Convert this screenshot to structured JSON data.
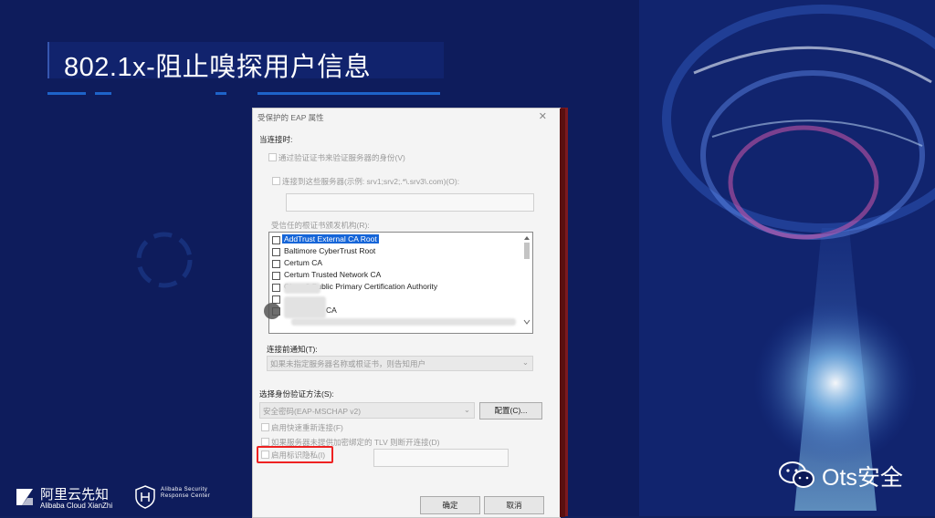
{
  "slide": {
    "title": "802.1x-阻止嗅探用户信息",
    "brand_main": "阿里云先知",
    "brand_sub": "Alibaba Cloud XianZhi",
    "brand2_line1": "Alibaba Security",
    "brand2_line2": "Response Center",
    "wechat_label": "Ots安全"
  },
  "dialog": {
    "title": "受保护的 EAP 属性",
    "close_glyph": "✕",
    "connect_label": "当连接时:",
    "verify_cert_label": "通过验证证书来验证服务器的身份(V)",
    "connect_servers_label": "连接到这些服务器(示例: srv1;srv2;.*\\.srv3\\.com)(O):",
    "trusted_ca_label": "受信任的根证书颁发机构(R):",
    "ca_items": [
      "AddTrust External CA Root",
      "Baltimore CyberTrust Root",
      "Certum CA",
      "Certum Trusted Network CA",
      "Class 3 Public Primary Certification Authority"
    ],
    "ca_partial": "CA",
    "notify_label": "连接前通知(T):",
    "notify_value": "如果未指定服务器名称或根证书，则告知用户",
    "auth_method_label": "选择身份验证方法(S):",
    "auth_method_value": "安全密码(EAP-MSCHAP v2)",
    "configure_button": "配置(C)...",
    "fast_reconnect_label": "启用快速重新连接(F)",
    "tlv_label": "如果服务器未提供加密绑定的 TLV 则断开连接(D)",
    "identity_privacy_label": "启用标识隐私(I)",
    "ok_button": "确定",
    "cancel_button": "取消"
  },
  "colors": {
    "accent": "#1565d8",
    "highlight": "#e22222",
    "background": "#0c1a57"
  }
}
